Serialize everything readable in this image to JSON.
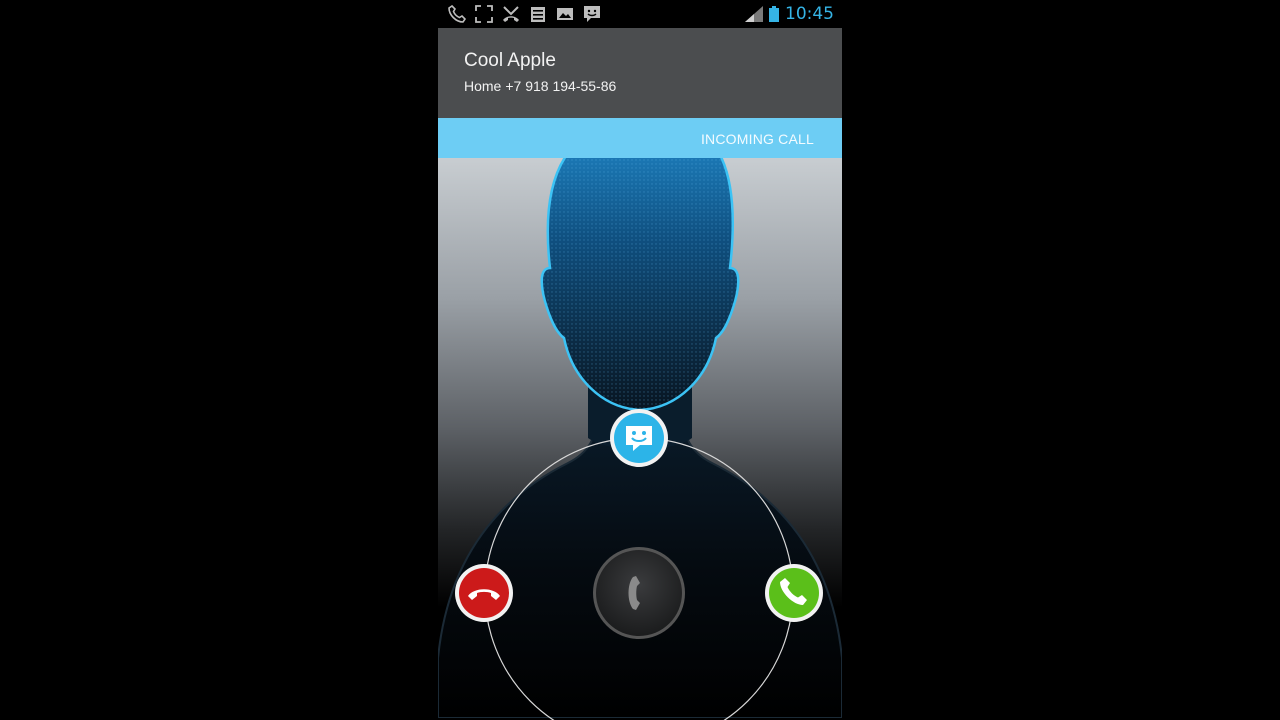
{
  "status_bar": {
    "time": "10:45",
    "icons": [
      "phone-icon",
      "screenshot-icon",
      "missed-call-icon",
      "clipboard-icon",
      "gallery-icon",
      "message-icon",
      "signal-icon",
      "battery-icon"
    ]
  },
  "caller": {
    "name": "Cool Apple",
    "number_label": "Home",
    "number": "+7 918 194-55-86"
  },
  "call_status": "INCOMING CALL",
  "controls": {
    "message": "message-icon",
    "decline": "hang-up-icon",
    "answer": "phone-icon",
    "handle": "phone-handle-icon"
  },
  "colors": {
    "accent": "#35b4e6",
    "incoming_bar": "#6dcdf4",
    "caller_bg": "#4b4d4f",
    "decline": "#d01c1c",
    "answer": "#5fc11b"
  }
}
